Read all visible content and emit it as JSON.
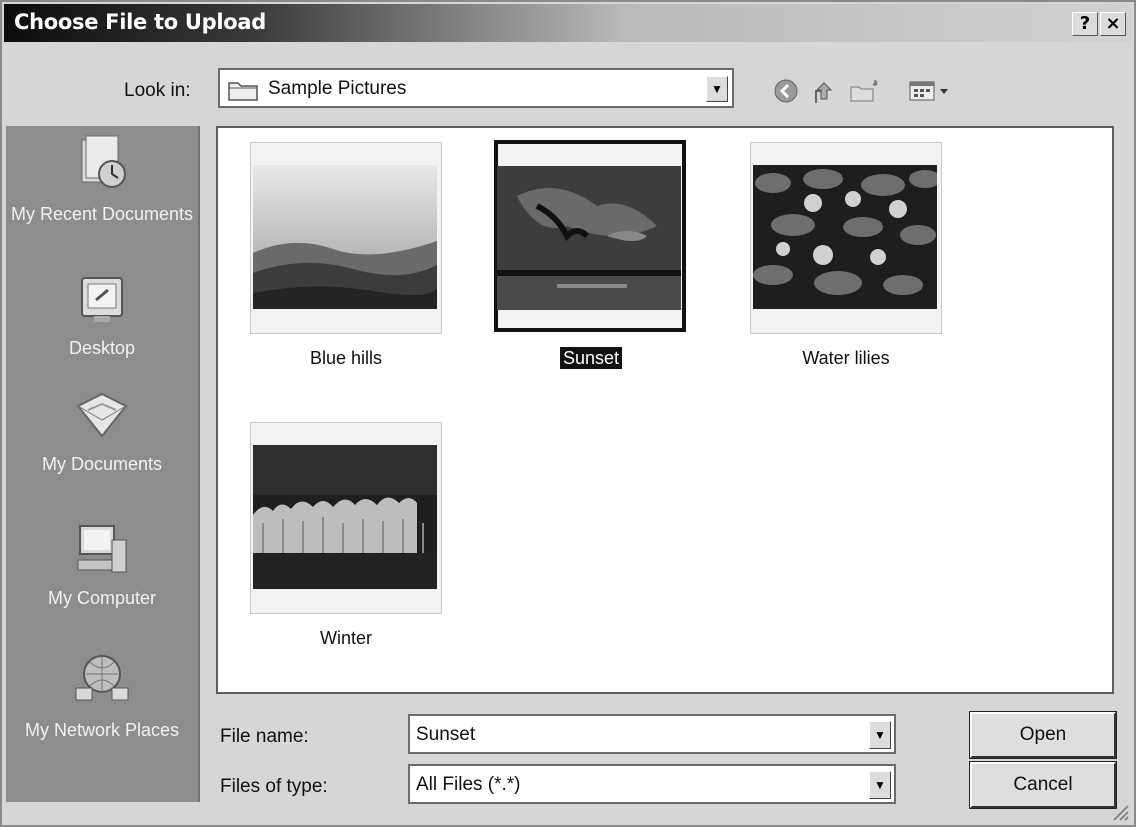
{
  "window": {
    "title": "Choose File to Upload",
    "help_label": "?",
    "close_label": "×"
  },
  "toolbar": {
    "look_in_label": "Look in:",
    "look_in_value": "Sample Pictures",
    "icons": [
      "back-icon",
      "up-folder-icon",
      "new-folder-icon",
      "views-menu-icon"
    ]
  },
  "places": [
    {
      "label": "My Recent Documents",
      "icon": "recent-documents-icon"
    },
    {
      "label": "Desktop",
      "icon": "desktop-icon"
    },
    {
      "label": "My Documents",
      "icon": "my-documents-icon"
    },
    {
      "label": "My Computer",
      "icon": "my-computer-icon"
    },
    {
      "label": "My Network Places",
      "icon": "network-places-icon"
    }
  ],
  "files": [
    {
      "name": "Blue hills",
      "selected": false
    },
    {
      "name": "Sunset",
      "selected": true
    },
    {
      "name": "Water lilies",
      "selected": false
    },
    {
      "name": "Winter",
      "selected": false
    }
  ],
  "form": {
    "file_name_label": "File name:",
    "file_name_value": "Sunset",
    "files_of_type_label": "Files of type:",
    "files_of_type_value": "All Files (*.*)"
  },
  "buttons": {
    "open_label": "Open",
    "cancel_label": "Cancel"
  }
}
